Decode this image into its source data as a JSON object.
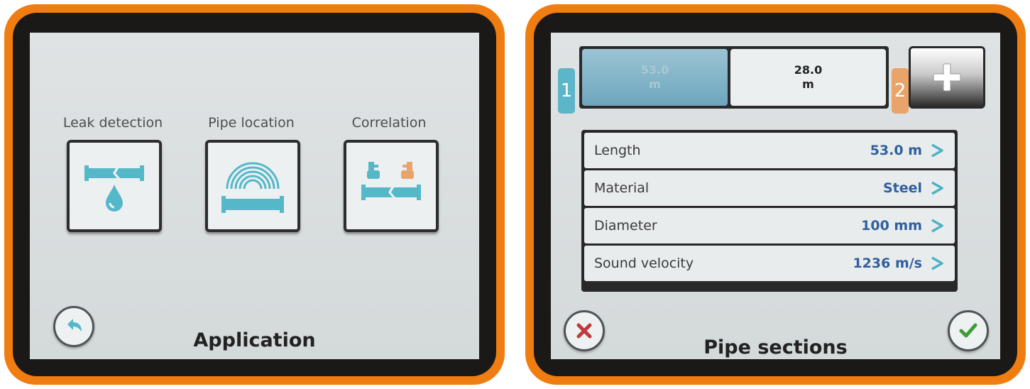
{
  "application_screen": {
    "title": "Application",
    "options": [
      {
        "label": "Leak detection",
        "icon": "leak-detection-icon"
      },
      {
        "label": "Pipe location",
        "icon": "pipe-location-icon"
      },
      {
        "label": "Correlation",
        "icon": "correlation-icon"
      }
    ],
    "back_icon": "back-arrow-icon"
  },
  "pipe_sections_screen": {
    "title": "Pipe sections",
    "sensor_1": "1",
    "sensor_2": "2",
    "segments": [
      {
        "value": "53.0",
        "unit": "m",
        "active": true
      },
      {
        "value": "28.0",
        "unit": "m",
        "active": false
      }
    ],
    "add_icon": "plus-icon",
    "parameters": [
      {
        "label": "Length",
        "value": "53.0 m"
      },
      {
        "label": "Material",
        "value": "Steel"
      },
      {
        "label": "Diameter",
        "value": "100 mm"
      },
      {
        "label": "Sound velocity",
        "value": "1236 m/s"
      }
    ],
    "cancel_icon": "cancel-x-icon",
    "confirm_icon": "confirm-check-icon"
  },
  "colors": {
    "frame_orange": "#f07d12",
    "bezel": "#1b1917",
    "screen_bg": "#dfe3e4",
    "icon_teal": "#54b8c8",
    "sensor_1_blue": "#5cb5c8",
    "sensor_2_orange": "#e9a46a",
    "value_blue": "#2f5f9e",
    "chevron_teal": "#4ab3c4",
    "cancel_red": "#c0393b",
    "confirm_green": "#3c9c36"
  }
}
